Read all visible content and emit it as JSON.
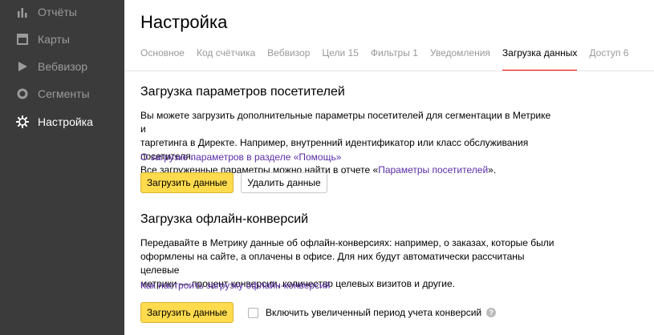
{
  "sidebar": {
    "items": [
      {
        "label": "Отчёты",
        "icon": "bar-chart-icon"
      },
      {
        "label": "Карты",
        "icon": "map-square-icon"
      },
      {
        "label": "Вебвизор",
        "icon": "play-icon"
      },
      {
        "label": "Сегменты",
        "icon": "segments-ring-icon"
      },
      {
        "label": "Настройка",
        "icon": "gear-icon",
        "active": true
      }
    ]
  },
  "header": {
    "title": "Настройка"
  },
  "tabs": [
    {
      "label": "Основное"
    },
    {
      "label": "Код счётчика"
    },
    {
      "label": "Вебвизор"
    },
    {
      "label": "Цели 15"
    },
    {
      "label": "Фильтры 1"
    },
    {
      "label": "Уведомления"
    },
    {
      "label": "Загрузка данных",
      "active": true
    },
    {
      "label": "Доступ 6"
    }
  ],
  "visitors_section": {
    "title": "Загрузка параметров посетителей",
    "desc_line1": "Вы можете загрузить дополнительные параметры посетителей для сегментации в Метрике и",
    "desc_line2": "таргетинга в Директе. Например, внутренний идентификатор или класс обслуживания посетителя.",
    "desc_line3_prefix": "Все загруженные параметры можно найти в отчете «",
    "desc_line3_link": "Параметры посетителей",
    "desc_line3_suffix": "».",
    "help_link": "О загрузке параметров в разделе «Помощь»",
    "upload_button": "Загрузить данные",
    "delete_button": "Удалить данные"
  },
  "offline_section": {
    "title": "Загрузка офлайн-конверсий",
    "desc_line1": "Передавайте в Метрику данные об офлайн-конверсиях: например, о заказах, которые были",
    "desc_line2": "оформлены на сайте, а оплачены в офисе. Для них будут автоматически рассчитаны целевые",
    "desc_line3": "метрики — процент конверсии, количество целевых визитов и другие.",
    "help_link": "Как настроить загрузку офлайн-конверсий",
    "upload_button": "Загрузить данные",
    "checkbox_label": "Включить увеличенный период учета конверсий",
    "help_icon_glyph": "?"
  },
  "colors": {
    "sidebar_bg": "#3b3b3b",
    "accent_yellow": "#ffdb4d",
    "active_tab_underline": "#ff0000",
    "link": "#5a2ea6"
  }
}
